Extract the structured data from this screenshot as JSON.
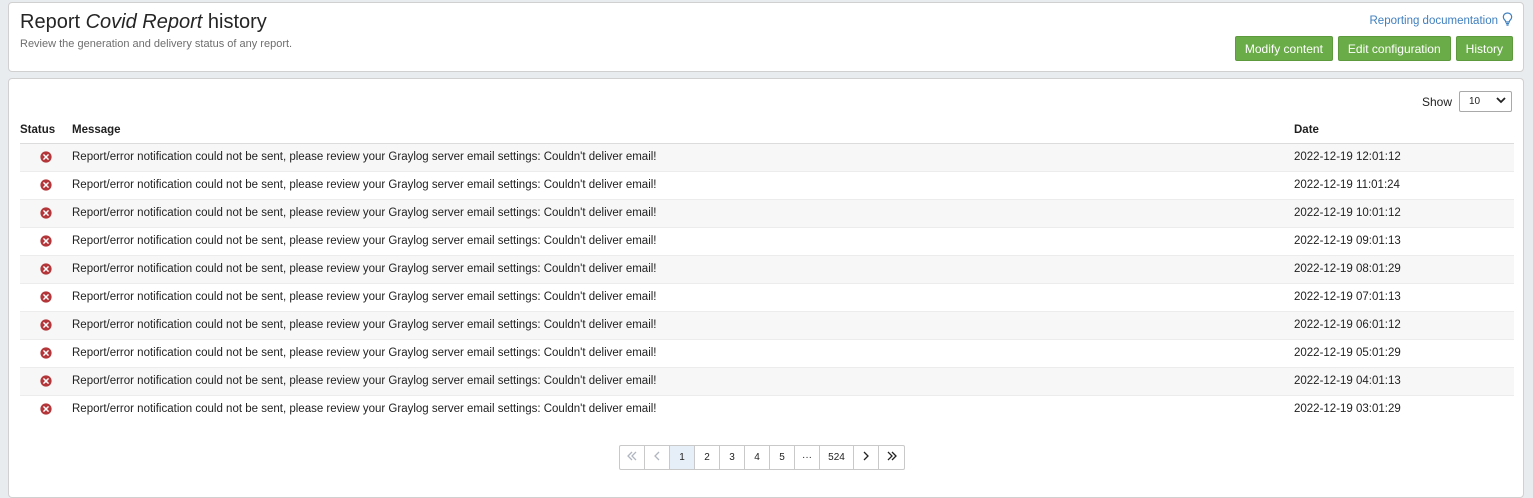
{
  "header": {
    "title_prefix": "Report",
    "title_name": "Covid Report",
    "title_suffix": "history",
    "subtitle": "Review the generation and delivery status of any report.",
    "doc_link": "Reporting documentation",
    "buttons": {
      "modify": "Modify content",
      "edit": "Edit configuration",
      "history": "History"
    }
  },
  "list": {
    "show_label": "Show",
    "page_size": "10",
    "columns": {
      "status": "Status",
      "message": "Message",
      "date": "Date"
    },
    "rows": [
      {
        "status": "error",
        "message": "Report/error notification could not be sent, please review your Graylog server email settings: Couldn't deliver email!",
        "date": "2022-12-19 12:01:12"
      },
      {
        "status": "error",
        "message": "Report/error notification could not be sent, please review your Graylog server email settings: Couldn't deliver email!",
        "date": "2022-12-19 11:01:24"
      },
      {
        "status": "error",
        "message": "Report/error notification could not be sent, please review your Graylog server email settings: Couldn't deliver email!",
        "date": "2022-12-19 10:01:12"
      },
      {
        "status": "error",
        "message": "Report/error notification could not be sent, please review your Graylog server email settings: Couldn't deliver email!",
        "date": "2022-12-19 09:01:13"
      },
      {
        "status": "error",
        "message": "Report/error notification could not be sent, please review your Graylog server email settings: Couldn't deliver email!",
        "date": "2022-12-19 08:01:29"
      },
      {
        "status": "error",
        "message": "Report/error notification could not be sent, please review your Graylog server email settings: Couldn't deliver email!",
        "date": "2022-12-19 07:01:13"
      },
      {
        "status": "error",
        "message": "Report/error notification could not be sent, please review your Graylog server email settings: Couldn't deliver email!",
        "date": "2022-12-19 06:01:12"
      },
      {
        "status": "error",
        "message": "Report/error notification could not be sent, please review your Graylog server email settings: Couldn't deliver email!",
        "date": "2022-12-19 05:01:29"
      },
      {
        "status": "error",
        "message": "Report/error notification could not be sent, please review your Graylog server email settings: Couldn't deliver email!",
        "date": "2022-12-19 04:01:13"
      },
      {
        "status": "error",
        "message": "Report/error notification could not be sent, please review your Graylog server email settings: Couldn't deliver email!",
        "date": "2022-12-19 03:01:29"
      }
    ]
  },
  "pagination": {
    "pages": [
      "1",
      "2",
      "3",
      "4",
      "5"
    ],
    "ellipsis": "···",
    "last_page": "524",
    "current_page": "1"
  },
  "colors": {
    "accent_button": "#6aac48",
    "link": "#3f7fbf",
    "error": "#b3373a"
  }
}
